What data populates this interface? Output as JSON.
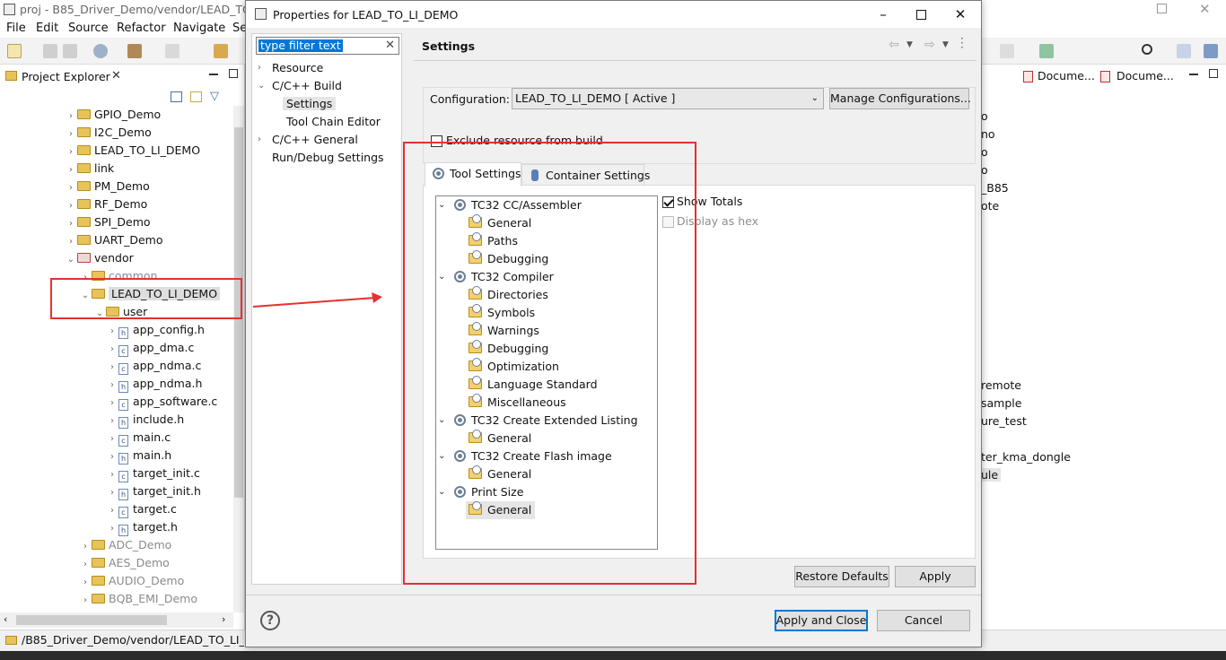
{
  "ide": {
    "title": "proj - B85_Driver_Demo/vendor/LEAD_TO_L",
    "menu": [
      "File",
      "Edit",
      "Source",
      "Refactor",
      "Navigate",
      "Se"
    ],
    "project_explorer_title": "Project Explorer",
    "tree": [
      {
        "label": "GPIO_Demo"
      },
      {
        "label": "I2C_Demo"
      },
      {
        "label": "LEAD_TO_LI_DEMO"
      },
      {
        "label": "link"
      },
      {
        "label": "PM_Demo"
      },
      {
        "label": "RF_Demo"
      },
      {
        "label": "SPI_Demo"
      },
      {
        "label": "UART_Demo"
      },
      {
        "label": "vendor"
      },
      {
        "label": "common"
      },
      {
        "label": "LEAD_TO_LI_DEMO"
      },
      {
        "label": "user"
      },
      {
        "label": "app_config.h"
      },
      {
        "label": "app_dma.c"
      },
      {
        "label": "app_ndma.c"
      },
      {
        "label": "app_ndma.h"
      },
      {
        "label": "app_software.c"
      },
      {
        "label": "include.h"
      },
      {
        "label": "main.c"
      },
      {
        "label": "main.h"
      },
      {
        "label": "target_init.c"
      },
      {
        "label": "target_init.h"
      },
      {
        "label": "target.c"
      },
      {
        "label": "target.h"
      },
      {
        "label": "ADC_Demo"
      },
      {
        "label": "AES_Demo"
      },
      {
        "label": "AUDIO_Demo"
      },
      {
        "label": "BQB_EMI_Demo"
      }
    ],
    "status_path": "/B85_Driver_Demo/vendor/LEAD_TO_LI_DEM",
    "right_tabs": [
      "Docume...",
      "Docume..."
    ],
    "right_list": [
      "o",
      "no",
      "o",
      "o",
      "_B85",
      "ote",
      "remote",
      "sample",
      "ure_test",
      "ter_kma_dongle",
      "ule"
    ]
  },
  "dialog": {
    "title": "Properties for LEAD_TO_LI_DEMO",
    "filter_text": "type filter text",
    "nav": {
      "resource": "Resource",
      "cpp_build": "C/C++ Build",
      "settings": "Settings",
      "tool_chain_editor": "Tool Chain Editor",
      "cpp_general": "C/C++ General",
      "run_debug": "Run/Debug Settings"
    },
    "settings_title": "Settings",
    "configuration_label": "Configuration:",
    "configuration_value": "LEAD_TO_LI_DEMO  [ Active ]",
    "manage_configurations": "Manage Configurations...",
    "exclude_resource": "Exclude resource from build",
    "tabs": {
      "tool_settings": "Tool Settings",
      "container_settings": "Container Settings"
    },
    "tool_tree": {
      "cc_assembler": "TC32 CC/Assembler",
      "cc_general": "General",
      "cc_paths": "Paths",
      "cc_debugging": "Debugging",
      "compiler": "TC32 Compiler",
      "comp_directories": "Directories",
      "comp_symbols": "Symbols",
      "comp_warnings": "Warnings",
      "comp_debugging": "Debugging",
      "comp_optimization": "Optimization",
      "comp_language": "Language Standard",
      "comp_misc": "Miscellaneous",
      "ext_listing": "TC32 Create Extended Listing",
      "ext_general": "General",
      "flash_image": "TC32 Create Flash image",
      "flash_general": "General",
      "print_size": "Print Size",
      "print_general": "General"
    },
    "show_totals": "Show Totals",
    "display_as_hex": "Display as hex",
    "restore_defaults": "Restore Defaults",
    "apply": "Apply",
    "apply_and_close": "Apply and Close",
    "cancel": "Cancel"
  }
}
